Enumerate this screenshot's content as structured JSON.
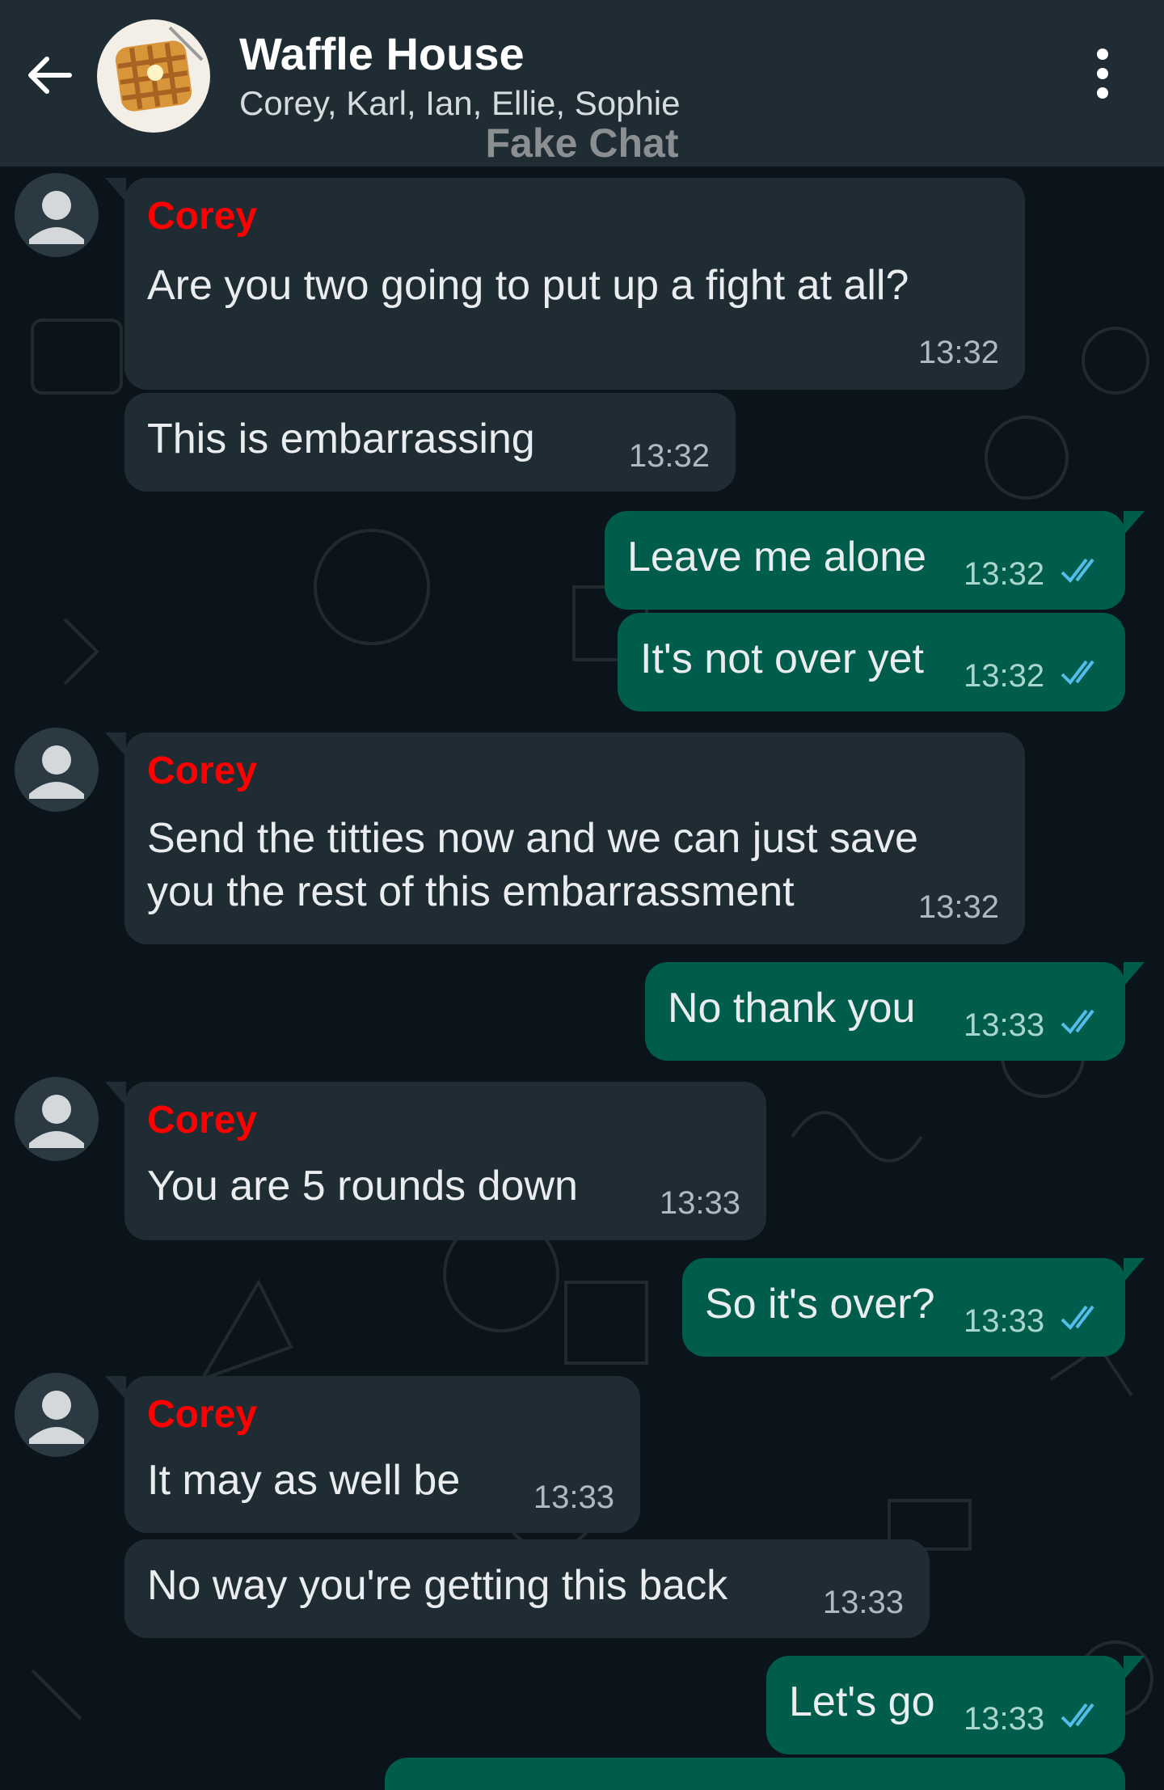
{
  "header": {
    "title": "Waffle House",
    "members": "Corey, Karl, Ian, Ellie, Sophie",
    "watermark": "Fake Chat"
  },
  "colors": {
    "header_bg": "#1f2c34",
    "chat_bg": "#0b141a",
    "incoming_bubble": "#202c33",
    "outgoing_bubble": "#005c4b",
    "sender_name": "#ff0000",
    "read_ticks": "#53bdeb"
  },
  "messages": [
    {
      "dir": "in",
      "sender": "Corey",
      "text": "Are you two going to put up a fight at all?",
      "time": "13:32"
    },
    {
      "dir": "in",
      "text": "This is embarrassing",
      "time": "13:32"
    },
    {
      "dir": "out",
      "text": "Leave me alone",
      "time": "13:32",
      "status": "read"
    },
    {
      "dir": "out",
      "text": "It's not over yet",
      "time": "13:32",
      "status": "read"
    },
    {
      "dir": "in",
      "sender": "Corey",
      "text_line1": "Send the titties now and we can just save",
      "text_line2": "you the rest of this embarrassment",
      "time": "13:32"
    },
    {
      "dir": "out",
      "text": "No thank you",
      "time": "13:33",
      "status": "read"
    },
    {
      "dir": "in",
      "sender": "Corey",
      "text": "You are 5 rounds down",
      "time": "13:33"
    },
    {
      "dir": "out",
      "text": "So it's over?",
      "time": "13:33",
      "status": "read"
    },
    {
      "dir": "in",
      "sender": "Corey",
      "text": "It may as well be",
      "time": "13:33"
    },
    {
      "dir": "in",
      "text": "No way you're getting this back",
      "time": "13:33"
    },
    {
      "dir": "out",
      "text": "Let's go",
      "time": "13:33",
      "status": "read"
    }
  ]
}
